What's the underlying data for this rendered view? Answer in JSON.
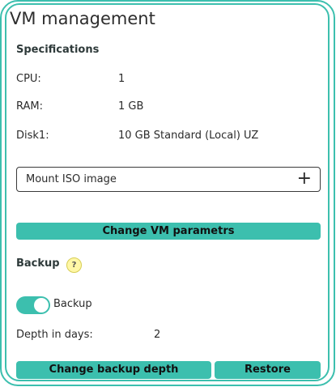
{
  "title": "VM management",
  "specs": {
    "heading": "Specifications",
    "rows": [
      {
        "label": "CPU:",
        "value": "1"
      },
      {
        "label": "RAM:",
        "value": "1 GB"
      },
      {
        "label": "Disk1:",
        "value": "10 GB Standard (Local) UZ"
      }
    ]
  },
  "iso": {
    "label": "Mount ISO image",
    "add_icon": "+"
  },
  "buttons": {
    "change_params": "Change VM parametrs",
    "change_depth": "Change backup depth",
    "restore": "Restore"
  },
  "backup": {
    "heading": "Backup",
    "help_icon": "?",
    "toggle_label": "Backup",
    "toggle_on": true,
    "depth_label": "Depth in days:",
    "depth_value": "2"
  },
  "colors": {
    "accent": "#3cbfae",
    "help_badge": "#fff7a6"
  }
}
